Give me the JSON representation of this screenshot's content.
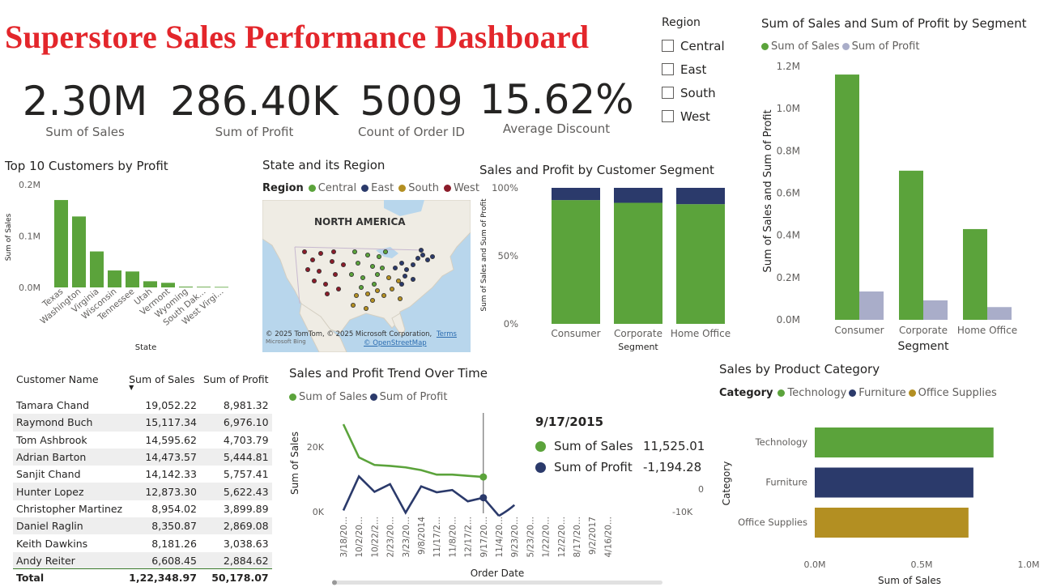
{
  "dashboard": {
    "title": "Superstore Sales Performance Dashboard"
  },
  "kpis": [
    {
      "value": "2.30M",
      "label": "Sum of Sales"
    },
    {
      "value": "286.40K",
      "label": "Sum of Profit"
    },
    {
      "value": "5009",
      "label": "Count of Order ID"
    },
    {
      "value": "15.62%",
      "label": "Average Discount"
    }
  ],
  "region_slicer": {
    "title": "Region",
    "options": [
      {
        "label": "Central",
        "checked": false
      },
      {
        "label": "East",
        "checked": false
      },
      {
        "label": "South",
        "checked": false
      },
      {
        "label": "West",
        "checked": false
      }
    ]
  },
  "colors": {
    "sales_green": "#5ba33b",
    "profit_navy": "#2b3a6b",
    "profit_lavender": "#a9adc9",
    "south_gold": "#b38f22",
    "west_maroon": "#8b1c2a",
    "title_red": "#e3262b"
  },
  "top_customers": {
    "title": "Top 10 Customers by Profit",
    "chart_data": {
      "type": "bar",
      "categories": [
        "Texas",
        "Washington",
        "Virginia",
        "Wisconsin",
        "Tennessee",
        "Utah",
        "Vermont",
        "Wyoming",
        "South Dak...",
        "West Virgi..."
      ],
      "values": [
        170000,
        138000,
        70000,
        33000,
        31000,
        12000,
        9000,
        1600,
        1300,
        1000
      ],
      "xlabel": "State",
      "ylabel": "Sum of Sales",
      "yticks": [
        "0.0M",
        "0.1M",
        "0.2M"
      ],
      "ylim": [
        0,
        200000
      ]
    }
  },
  "state_map": {
    "title": "State and its Region",
    "legend_title": "Region",
    "legend": [
      "Central",
      "East",
      "South",
      "West"
    ],
    "map_label": "NORTH AMERICA",
    "attribution": "© 2025 TomTom, © 2025 Microsoft Corporation,",
    "terms": "Terms",
    "osm": "© OpenStreetMap",
    "bing": "Microsoft Bing"
  },
  "segment_stacked": {
    "title": "Sales and Profit by Customer Segment",
    "chart_data": {
      "type": "bar",
      "stacked": "100%",
      "categories": [
        "Consumer",
        "Corporate",
        "Home Office"
      ],
      "series": [
        {
          "name": "Sum of Sales",
          "values": [
            91,
            89,
            88
          ]
        },
        {
          "name": "Sum of Profit",
          "values": [
            9,
            11,
            12
          ]
        }
      ],
      "yticks": [
        "0%",
        "50%",
        "100%"
      ],
      "xlabel": "Segment",
      "ylabel": "Sum of Sales and Sum of Profit"
    }
  },
  "segment_clustered": {
    "title": "Sum of Sales and Sum of Profit by Segment",
    "legend": [
      "Sum of Sales",
      "Sum of Profit"
    ],
    "chart_data": {
      "type": "bar",
      "categories": [
        "Consumer",
        "Corporate",
        "Home Office"
      ],
      "series": [
        {
          "name": "Sum of Sales",
          "values": [
            1161401,
            706146,
            429653
          ]
        },
        {
          "name": "Sum of Profit",
          "values": [
            134119,
            91979,
            60299
          ]
        }
      ],
      "yticks": [
        "0.0M",
        "0.2M",
        "0.4M",
        "0.6M",
        "0.8M",
        "1.0M",
        "1.2M"
      ],
      "ylim": [
        0,
        1200000
      ],
      "xlabel": "Segment",
      "ylabel": "Sum of Sales and Sum of Profit"
    }
  },
  "customer_table": {
    "columns": [
      "Customer Name",
      "Sum of Sales",
      "Sum of Profit"
    ],
    "rows": [
      [
        "Tamara Chand",
        "19,052.22",
        "8,981.32"
      ],
      [
        "Raymond Buch",
        "15,117.34",
        "6,976.10"
      ],
      [
        "Tom Ashbrook",
        "14,595.62",
        "4,703.79"
      ],
      [
        "Adrian Barton",
        "14,473.57",
        "5,444.81"
      ],
      [
        "Sanjit Chand",
        "14,142.33",
        "5,757.41"
      ],
      [
        "Hunter Lopez",
        "12,873.30",
        "5,622.43"
      ],
      [
        "Christopher Martinez",
        "8,954.02",
        "3,899.89"
      ],
      [
        "Daniel Raglin",
        "8,350.87",
        "2,869.08"
      ],
      [
        "Keith Dawkins",
        "8,181.26",
        "3,038.63"
      ],
      [
        "Andy Reiter",
        "6,608.45",
        "2,884.62"
      ]
    ],
    "total": [
      "Total",
      "1,22,348.97",
      "50,178.07"
    ]
  },
  "trend": {
    "title": "Sales and Profit Trend Over Time",
    "legend": [
      "Sum of Sales",
      "Sum of Profit"
    ],
    "chart_data": {
      "type": "line",
      "x": [
        "3/18/20...",
        "10/2/20...",
        "10/22/2...",
        "2/23/20...",
        "3/23/20...",
        "9/8/2014",
        "11/17/2...",
        "11/8/20...",
        "12/17/2...",
        "9/17/20...",
        "11/4/20...",
        "9/23/20...",
        "5/23/20...",
        "1/22/20...",
        "12/2/20...",
        "8/17/20...",
        "9/2/2017",
        "4/16/20..."
      ],
      "series": [
        {
          "name": "Sum of Sales",
          "values": [
            29000,
            18000,
            15500,
            15200,
            14700,
            13800,
            12300,
            12300,
            11900,
            11525.01
          ]
        },
        {
          "name": "Sum of Profit",
          "values": [
            -4000,
            3500,
            100,
            1800,
            -4500,
            1300,
            0,
            500,
            -2000,
            -1194.28,
            -5200
          ]
        }
      ],
      "xlabel": "Order Date",
      "ylabel": "Sum of Sales",
      "yticks_left": [
        "0K",
        "20K"
      ],
      "yticks_right": [
        "-10K",
        "0"
      ]
    },
    "tooltip": {
      "date": "9/17/2015",
      "rows": [
        {
          "label": "Sum of Sales",
          "value": "11,525.01"
        },
        {
          "label": "Sum of Profit",
          "value": "-1,194.28"
        }
      ]
    }
  },
  "category": {
    "title": "Sales by Product Category",
    "legend_title": "Category",
    "legend": [
      "Technology",
      "Furniture",
      "Office Supplies"
    ],
    "chart_data": {
      "type": "bar",
      "orientation": "horizontal",
      "categories": [
        "Technology",
        "Furniture",
        "Office Supplies"
      ],
      "values": [
        836154,
        741999,
        719047
      ],
      "xticks": [
        "0.0M",
        "0.5M",
        "1.0M"
      ],
      "xlim": [
        0,
        1000000
      ],
      "xlabel": "Sum of Sales",
      "ylabel": "Category"
    }
  }
}
